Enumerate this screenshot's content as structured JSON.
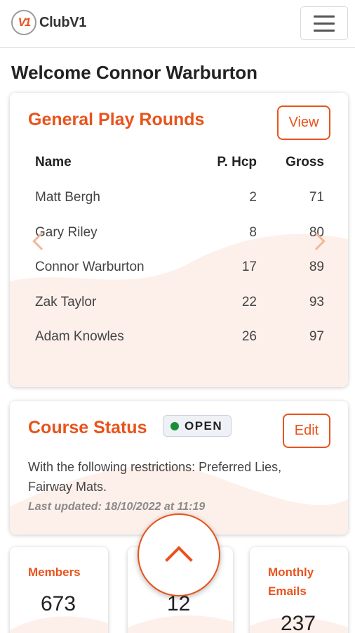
{
  "app": {
    "brand": "ClubV1",
    "logo_mark": "V1"
  },
  "header": {
    "menu_icon": "hamburger-menu-icon"
  },
  "welcome": "Welcome Connor Warburton",
  "rounds": {
    "title": "General Play Rounds",
    "view_label": "View",
    "columns": [
      "Name",
      "P. Hcp",
      "Gross"
    ],
    "rows": [
      [
        "Matt Bergh",
        "2",
        "71"
      ],
      [
        "Gary Riley",
        "8",
        "80"
      ],
      [
        "Connor Warburton",
        "17",
        "89"
      ],
      [
        "Zak Taylor",
        "22",
        "93"
      ],
      [
        "Adam Knowles",
        "26",
        "97"
      ]
    ]
  },
  "course": {
    "title": "Course Status",
    "badge": "OPEN",
    "badge_color": "#1a8f3a",
    "edit_label": "Edit",
    "restrictions": "With the following restrictions: Preferred Lies, Fairway Mats.",
    "updated": "Last updated: 18/10/2022 at 11:19"
  },
  "stats": [
    {
      "label": "Members",
      "value": "673"
    },
    {
      "label": "",
      "value": "12"
    },
    {
      "label": "Monthly Emails",
      "value": "237"
    }
  ],
  "colors": {
    "accent": "#e8531c",
    "wave": "#fdf0ea"
  }
}
